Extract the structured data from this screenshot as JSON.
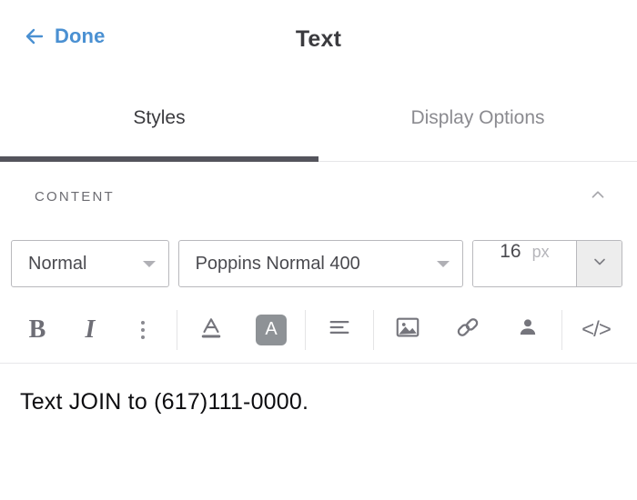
{
  "header": {
    "back_label": "Done",
    "back_icon": "arrow-left-icon",
    "title": "Text"
  },
  "tabs": [
    {
      "label": "Styles",
      "active": true
    },
    {
      "label": "Display Options",
      "active": false
    }
  ],
  "section": {
    "title": "CONTENT",
    "collapse_icon": "chevron-up-icon"
  },
  "controls": {
    "style_select": {
      "value": "Normal",
      "caret_icon": "caret-down-icon"
    },
    "font_select": {
      "value": "Poppins Normal 400",
      "caret_icon": "caret-down-icon"
    },
    "font_size": {
      "value": "16",
      "unit": "px",
      "stepper_icon": "chevron-down-icon"
    }
  },
  "toolbar": {
    "bold": "B",
    "italic": "I",
    "more": "more-vertical-icon",
    "text_color": "A",
    "highlight": "A",
    "align": "align-left-icon",
    "image": "image-icon",
    "link": "link-icon",
    "merge_field": "person-icon",
    "code": "</>"
  },
  "editor": {
    "content": "Text JOIN to (617)111-0000."
  },
  "colors": {
    "accent_blue": "#4a90d2",
    "active_tab_underline": "#54545c",
    "highlight_swatch": "#8e9296",
    "border": "#b9b9bd"
  }
}
